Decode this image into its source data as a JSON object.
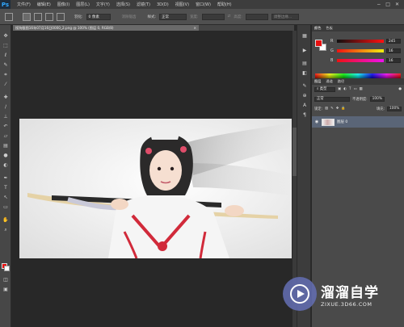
{
  "app": {
    "logo": "Ps"
  },
  "menu": [
    "文件(F)",
    "编辑(E)",
    "图像(I)",
    "图层(L)",
    "文字(Y)",
    "选择(S)",
    "滤镜(T)",
    "3D(D)",
    "视图(V)",
    "窗口(W)",
    "帮助(H)"
  ],
  "window_controls": [
    "−",
    "□",
    "✕"
  ],
  "options": {
    "feather_label": "羽化:",
    "feather_value": "0 像素",
    "antialias_label": "消除锯齿",
    "style_label": "样式:",
    "style_value": "正常",
    "width_label": "宽度:",
    "height_label": "高度:",
    "refine_edge_label": "调整边缘..."
  },
  "document": {
    "tab_title": "搜狗截图16年07月16日0000_2.png @ 100% (图层 0, RGB/8)"
  },
  "toolbar": {
    "tools": [
      "move-icon",
      "marquee-icon",
      "lasso-icon",
      "quick-select-icon",
      "crop-icon",
      "eyedropper-icon",
      "healing-icon",
      "brush-icon",
      "clone-stamp-icon",
      "history-brush-icon",
      "eraser-icon",
      "gradient-icon",
      "blur-icon",
      "dodge-icon",
      "pen-icon",
      "type-icon",
      "path-select-icon",
      "shape-icon",
      "hand-icon",
      "zoom-icon"
    ],
    "foreground_color": "#e81010",
    "background_color": "#ffffff"
  },
  "color_panel": {
    "tabs": [
      "颜色",
      "色板"
    ],
    "r_label": "R",
    "r_value": "245",
    "g_label": "G",
    "g_value": "16",
    "b_label": "B",
    "b_value": "16"
  },
  "layers_panel": {
    "tabs": [
      "图层",
      "通道",
      "路径"
    ],
    "kind_label": "类型",
    "blend_mode": "正常",
    "opacity_label": "不透明度:",
    "opacity_value": "100%",
    "lock_label": "锁定:",
    "fill_label": "填充:",
    "fill_value": "100%",
    "layers": [
      {
        "name": "图层 0"
      }
    ]
  },
  "watermark": {
    "main": "溜溜自学",
    "sub": "ZIXUE.3D66.COM"
  }
}
